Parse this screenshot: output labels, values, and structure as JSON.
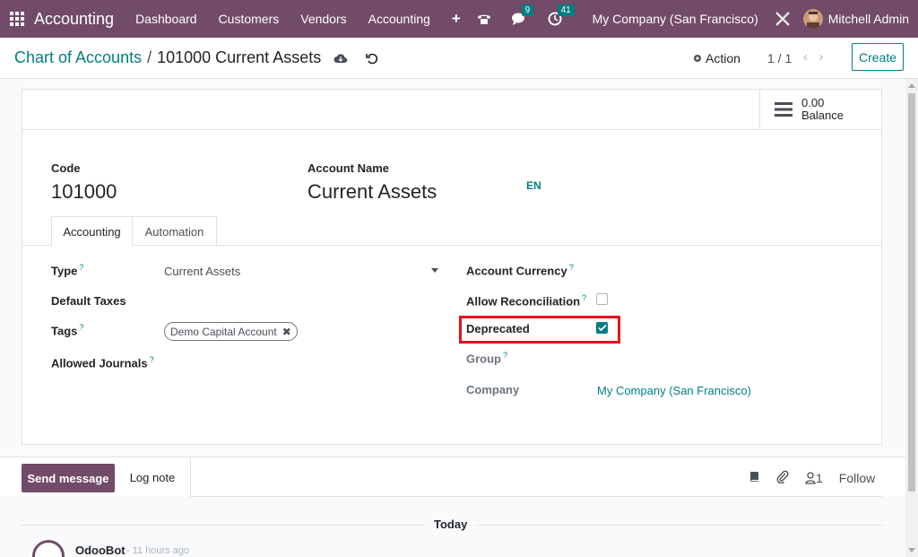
{
  "navbar": {
    "app_name": "Accounting",
    "menu": [
      "Dashboard",
      "Customers",
      "Vendors",
      "Accounting"
    ],
    "plus": "+",
    "messages_count": "9",
    "activities_count": "41",
    "company": "My Company (San Francisco)",
    "user": "Mitchell Admin"
  },
  "breadcrumb": {
    "parent": "Chart of Accounts",
    "separator": "/",
    "current": "101000 Current Assets"
  },
  "control": {
    "action_label": "Action",
    "pager": "1 / 1",
    "create_label": "Create"
  },
  "buttonbox": {
    "balance_value": "0.00",
    "balance_label": "Balance"
  },
  "form": {
    "code_label": "Code",
    "code_value": "101000",
    "name_label": "Account Name",
    "name_value": "Current Assets",
    "lang": "EN"
  },
  "tabs": [
    "Accounting",
    "Automation"
  ],
  "fields": {
    "type_label": "Type",
    "type_value": "Current Assets",
    "default_taxes_label": "Default Taxes",
    "tags_label": "Tags",
    "tag_value": "Demo Capital Account",
    "allowed_journals_label": "Allowed Journals",
    "currency_label": "Account Currency",
    "reconcile_label": "Allow Reconciliation",
    "reconcile_checked": false,
    "deprecated_label": "Deprecated",
    "deprecated_checked": true,
    "group_label": "Group",
    "company_label": "Company",
    "company_value": "My Company (San Francisco)",
    "help_mark": "?"
  },
  "chatter": {
    "send_message": "Send message",
    "log_note": "Log note",
    "followers_count": "1",
    "follow": "Follow",
    "today": "Today",
    "author": "OdooBot",
    "time": "- 11 hours ago"
  },
  "colors": {
    "brand": "#714B67",
    "accent": "#017e84",
    "highlight": "#e5121b"
  }
}
